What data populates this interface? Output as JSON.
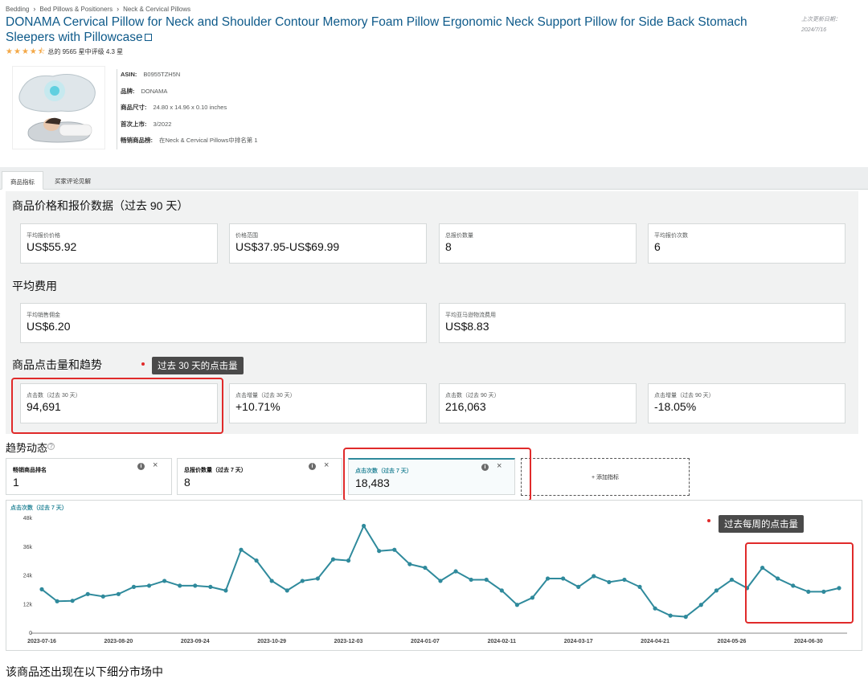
{
  "breadcrumb": [
    "Bedding",
    "Bed Pillows & Positioners",
    "Neck & Cervical Pillows"
  ],
  "product": {
    "title": "DONAMA Cervical Pillow for Neck and Shoulder Contour Memory Foam Pillow Ergonomic Neck Support Pillow for Side Back Stomach Sleepers with Pillowcase",
    "rating_text": "总的 9565 星中评级 4.3 星",
    "stars": 4.3,
    "last_update_label": "上次更新日期：",
    "last_update": "2024/7/16",
    "image_icon": "pillow-product-photo"
  },
  "info": [
    {
      "key": "ASIN:",
      "value": "B0955TZH5N"
    },
    {
      "key": "品牌:",
      "value": "DONAMA"
    },
    {
      "key": "商品尺寸:",
      "value": "24.80 x 14.96 x 0.10 inches"
    },
    {
      "key": "首次上市:",
      "value": "3/2022"
    },
    {
      "key": "畅销商品榜:",
      "value": "在Neck & Cervical Pillows中排名第 1"
    }
  ],
  "tabs": [
    "商品指标",
    "买家评论见解"
  ],
  "price_section": {
    "title": "商品价格和报价数据（过去 90 天）",
    "cards": [
      {
        "label": "平均报价价格",
        "value": "US$55.92"
      },
      {
        "label": "价格范围",
        "value": "US$37.95-US$69.99"
      },
      {
        "label": "总报价数量",
        "value": "8"
      },
      {
        "label": "平均报价次数",
        "value": "6"
      }
    ]
  },
  "fee_section": {
    "title": "平均费用",
    "cards": [
      {
        "label": "平均销售佣金",
        "value": "US$6.20"
      },
      {
        "label": "平均亚马逊物流费用",
        "value": "US$8.83"
      }
    ]
  },
  "click_section": {
    "title": "商品点击量和趋势",
    "tooltip": "过去 30 天的点击量",
    "cards": [
      {
        "label": "点击数（过去 30 天）",
        "value": "94,691"
      },
      {
        "label": "点击增量（过去 30 天）",
        "value": "+10.71%"
      },
      {
        "label": "点击数（过去 90 天）",
        "value": "216,063"
      },
      {
        "label": "点击增量（过去 90 天）",
        "value": "-18.05%"
      }
    ]
  },
  "trend": {
    "title": "趋势动态",
    "help_icon": "question-icon",
    "metric_cards": [
      {
        "label": "畅销商品排名",
        "value": "1"
      },
      {
        "label": "总报价数量（过去 7 天）",
        "value": "8"
      },
      {
        "label": "点击次数（过去 7 天）",
        "value": "18,483"
      }
    ],
    "add_label": "+ 添加指标",
    "weekly_tooltip": "过去每周的点击量"
  },
  "chart_data": {
    "type": "line",
    "title": "点击次数（过去 7 天）",
    "color": "#2f8a9c",
    "ylim": [
      0,
      48000
    ],
    "y_ticks": [
      0,
      12000,
      24000,
      36000,
      48000
    ],
    "y_tick_labels": [
      "0",
      "12k",
      "24k",
      "36k",
      "48k"
    ],
    "x_tick_labels": [
      "2023-07-16",
      "2023-08-20",
      "2023-09-24",
      "2023-10-29",
      "2023-12-03",
      "2024-01-07",
      "2024-02-11",
      "2024-03-17",
      "2024-04-21",
      "2024-05-26",
      "2024-06-30"
    ],
    "grid": false,
    "series": [
      {
        "values": [
          18000,
          13000,
          13200,
          16000,
          15000,
          16000,
          19000,
          19500,
          21500,
          19500,
          19500,
          19000,
          17500,
          34500,
          30000,
          21500,
          17500,
          21500,
          22500,
          30500,
          30000,
          44500,
          34000,
          34500,
          28500,
          27000,
          21500,
          25500,
          22000,
          22000,
          17500,
          11500,
          14500,
          22500,
          22500,
          19000,
          23500,
          21000,
          22000,
          19000,
          10000,
          7000,
          6500,
          11500,
          17500,
          22000,
          18500,
          27000,
          22500,
          19500,
          17000,
          17000,
          18500
        ]
      }
    ]
  },
  "bottom": {
    "title": "该商品还出现在以下细分市场中"
  },
  "colors": {
    "title_link": "#0e5a8a",
    "highlight": "#e02a2a",
    "accent": "#2f8a9c",
    "star": "#f3a847"
  }
}
